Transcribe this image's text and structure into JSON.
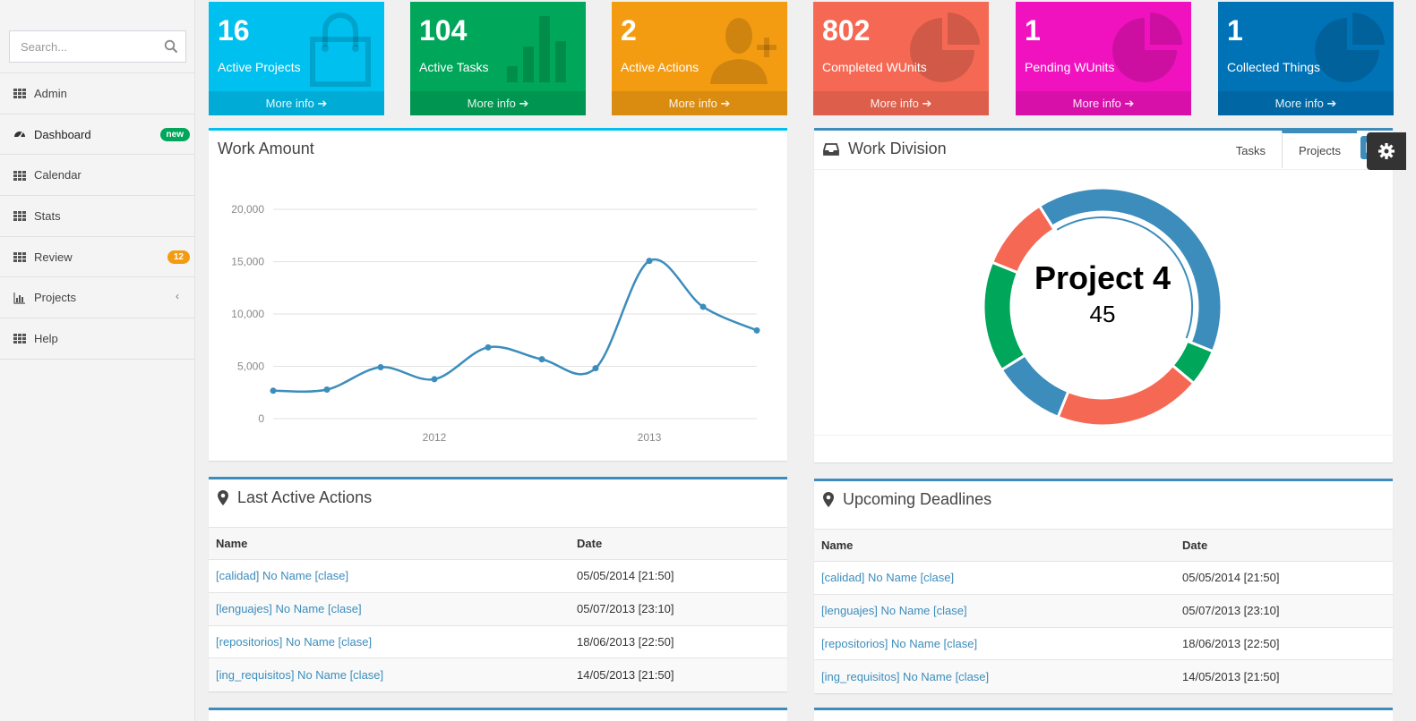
{
  "search": {
    "placeholder": "Search..."
  },
  "nav": [
    {
      "label": "Admin"
    },
    {
      "label": "Dashboard",
      "badge": "new",
      "badge_color": "#00a65a"
    },
    {
      "label": "Calendar"
    },
    {
      "label": "Stats"
    },
    {
      "label": "Review",
      "badge": "12",
      "badge_color": "#f39c12"
    },
    {
      "label": "Projects",
      "chevron": "‹"
    },
    {
      "label": "Help"
    }
  ],
  "info_boxes": [
    {
      "value": "16",
      "label": "Active Projects",
      "footer": "More info ➔",
      "color": "#00c0ef",
      "icon": "shopping-bag-icon"
    },
    {
      "value": "104",
      "label": "Active Tasks",
      "footer": "More info ➔",
      "color": "#00a65a",
      "icon": "bar-chart-icon"
    },
    {
      "value": "2",
      "label": "Active Actions",
      "footer": "More info ➔",
      "color": "#f39c12",
      "icon": "user-add-icon"
    },
    {
      "value": "802",
      "label": "Completed WUnits",
      "footer": "More info ➔",
      "color": "#f56954",
      "icon": "pie-chart-icon"
    },
    {
      "value": "1",
      "label": "Pending WUnits",
      "footer": "More info ➔",
      "color": "#f012be",
      "icon": "pie-chart-icon"
    },
    {
      "value": "1",
      "label": "Collected Things",
      "footer": "More info ➔",
      "color": "#0073b7",
      "icon": "pie-chart-icon"
    }
  ],
  "work_amount": {
    "title": "Work Amount",
    "chart_data": {
      "type": "line",
      "x": [
        "2011-07",
        "2011-10",
        "2012-01",
        "2012-04",
        "2012-07",
        "2012-10",
        "2013-01",
        "2013-04",
        "2013-07",
        "2013-10"
      ],
      "y_ticks": [
        "0",
        "5,000",
        "10,000",
        "15,000",
        "20,000"
      ],
      "x_ticks": [
        {
          "label": "2012",
          "at": "2012-04"
        },
        {
          "label": "2013",
          "at": "2013-04"
        }
      ],
      "series": [
        {
          "values": [
            2666,
            2778,
            4912,
            3767,
            6810,
            5670,
            4820,
            15073,
            10687,
            8432
          ],
          "color": "#3c8dbc"
        }
      ],
      "ylim": [
        0,
        20000
      ],
      "grid": true
    }
  },
  "work_division": {
    "title": "Work Division",
    "tabs": [
      "Tasks",
      "Projects"
    ],
    "active_tab": "Projects",
    "center_label": "Project 4",
    "center_value": "45",
    "chart_data": {
      "type": "pie",
      "categories": [
        "",
        "",
        "",
        "",
        "",
        ""
      ],
      "values": [
        40,
        5,
        20,
        10,
        15,
        10
      ],
      "colors": [
        "#3c8dbc",
        "#00a65a",
        "#f56954",
        "#3c8dbc",
        "#00a65a",
        "#f56954"
      ],
      "highlighted_index": 0
    }
  },
  "last_actions": {
    "title": "Last Active Actions",
    "columns": [
      "Name",
      "Date"
    ],
    "rows": [
      [
        "[calidad] No Name [clase]",
        "05/05/2014 [21:50]"
      ],
      [
        "[lenguajes] No Name [clase]",
        "05/07/2013 [23:10]"
      ],
      [
        "[repositorios] No Name [clase]",
        "18/06/2013 [22:50]"
      ],
      [
        "[ing_requisitos] No Name [clase]",
        "14/05/2013 [21:50]"
      ]
    ]
  },
  "deadlines": {
    "title": "Upcoming Deadlines",
    "columns": [
      "Name",
      "Date"
    ],
    "rows": [
      [
        "[calidad] No Name [clase]",
        "05/05/2014 [21:50]"
      ],
      [
        "[lenguajes] No Name [clase]",
        "05/07/2013 [23:10]"
      ],
      [
        "[repositorios] No Name [clase]",
        "18/06/2013 [22:50]"
      ],
      [
        "[ing_requisitos] No Name [clase]",
        "14/05/2013 [21:50]"
      ]
    ]
  }
}
